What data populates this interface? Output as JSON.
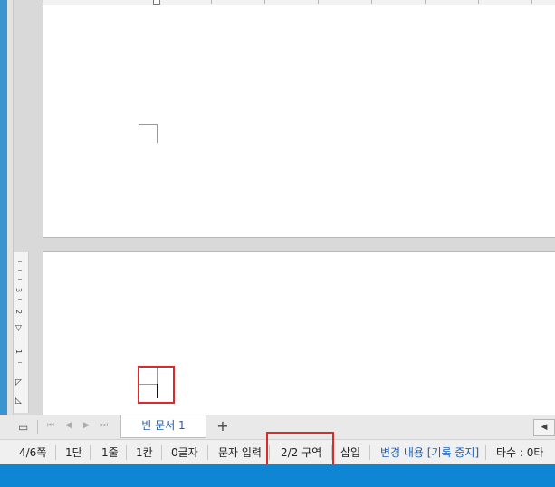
{
  "document": {
    "tab_name": "빈 문서 1",
    "add_tab_glyph": "+"
  },
  "ruler": {
    "vertical_numbers": [
      "3",
      "2",
      "1"
    ]
  },
  "status_bar": {
    "page": "4/6쪽",
    "column": "1단",
    "line": "1줄",
    "char_pos": "1칸",
    "char_count": "0글자",
    "input_mode": "문자 입력",
    "section": "2/2 구역",
    "insert_mode": "삽입",
    "track_changes": "변경 내용 [기록 중지]",
    "typing_count": "타수 : 0타"
  },
  "colors": {
    "highlight": "#d92b2b",
    "taskbar": "#0f86d4",
    "link_blue": "#1a5fb4"
  },
  "icons": {
    "sheet_view": "page-icon",
    "first": "first-page-icon",
    "prev": "prev-page-icon",
    "next": "next-page-icon",
    "last": "last-page-icon",
    "scroll_left": "scroll-left-icon"
  }
}
